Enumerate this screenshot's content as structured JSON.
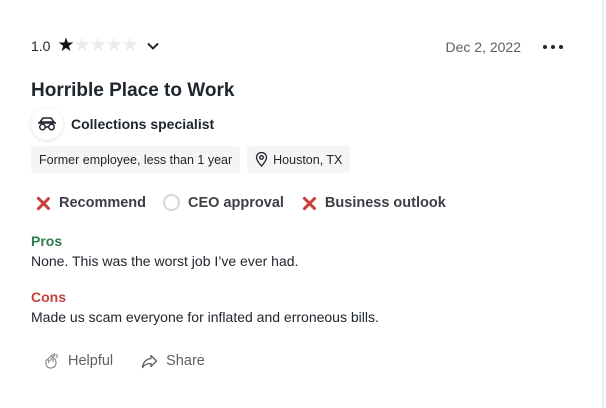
{
  "review": {
    "rating_value": "1.0",
    "stars_total": 5,
    "stars_filled": 1,
    "date": "Dec 2, 2022",
    "title": "Horrible Place to Work",
    "job_title": "Collections specialist",
    "employment_status": "Former employee, less than 1 year",
    "location": "Houston, TX",
    "indicators": [
      {
        "label": "Recommend",
        "state": "negative"
      },
      {
        "label": "CEO approval",
        "state": "neutral"
      },
      {
        "label": "Business outlook",
        "state": "negative"
      }
    ],
    "pros_label": "Pros",
    "pros_text": "None. This was the worst job I’ve ever had.",
    "cons_label": "Cons",
    "cons_text": "Made us scam everyone for inflated and erroneous bills."
  },
  "actions": {
    "helpful_label": "Helpful",
    "share_label": "Share"
  },
  "icons": {
    "filled_star": "star-filled-icon",
    "empty_star": "star-empty-icon",
    "expand": "chevron-down-icon",
    "more": "more-horizontal-icon",
    "job_logo": "company-logo-icon",
    "location": "location-pin-icon",
    "negative": "x-icon",
    "neutral": "empty-circle-icon",
    "helpful": "clap-hands-icon",
    "share": "share-arrow-icon"
  },
  "colors": {
    "text": "#20262e",
    "muted": "#5c6066",
    "pros": "#2f7c4b",
    "cons": "#c7413b",
    "chip_bg": "#f5f5f5"
  }
}
